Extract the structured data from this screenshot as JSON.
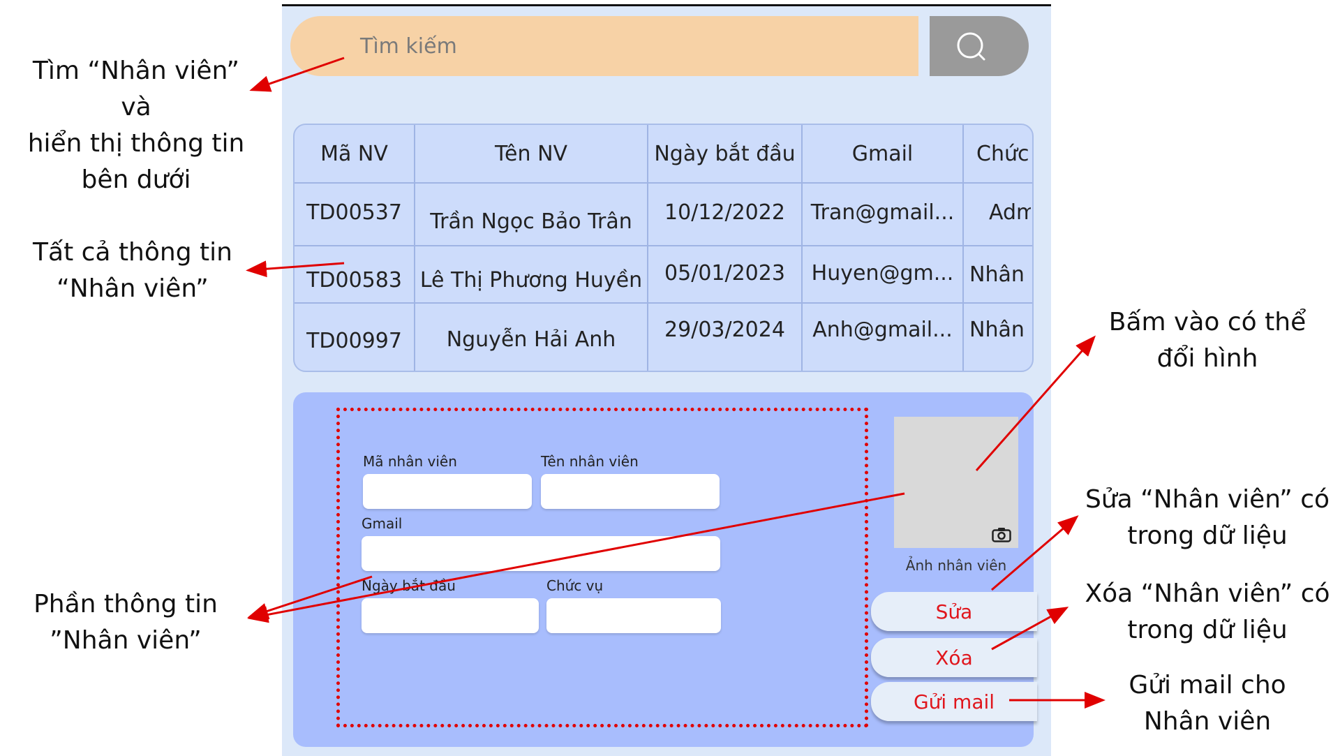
{
  "search": {
    "placeholder": "Tìm kiếm",
    "icon": "search-icon"
  },
  "table": {
    "headers": [
      "Mã NV",
      "Tên NV",
      "Ngày bắt đầu",
      "Gmail",
      "Chức"
    ],
    "rows": [
      [
        "TD00537",
        "Trần Ngọc Bảo Trân",
        "10/12/2022",
        "Tran@gmail...",
        "Adm"
      ],
      [
        "TD00583",
        "Lê Thị Phương Huyền",
        "05/01/2023",
        "Huyen@gm...",
        "Nhân v"
      ],
      [
        "TD00997",
        "Nguyễn Hải Anh",
        "29/03/2024",
        "Anh@gmail...",
        "Nhân v"
      ]
    ]
  },
  "form": {
    "ma_label": "Mã nhân viên",
    "ten_label": "Tên nhân viên",
    "gmail_label": "Gmail",
    "ngay_label": "Ngày bắt đầu",
    "chucvu_label": "Chức vụ",
    "ma_value": "",
    "ten_value": "",
    "gmail_value": "",
    "ngay_value": "",
    "chucvu_value": ""
  },
  "photo": {
    "label": "Ảnh nhân viên",
    "icon": "camera-icon"
  },
  "actions": {
    "edit": "Sửa",
    "delete": "Xóa",
    "mail": "Gửi mail"
  },
  "annotations": {
    "search_note": [
      "Tìm “Nhân viên” và",
      "hiển thị thông tin",
      "bên dưới"
    ],
    "table_note": [
      "Tất cả thông tin",
      "“Nhân viên”"
    ],
    "form_note": [
      "Phần thông tin",
      "”Nhân viên”"
    ],
    "photo_note": [
      "Bấm vào có thể",
      "đổi hình"
    ],
    "edit_note": [
      "Sửa “Nhân viên” có",
      "trong dữ liệu"
    ],
    "delete_note": [
      "Xóa “Nhân viên” có",
      "trong dữ liệu"
    ],
    "mail_note": [
      "Gửi mail cho",
      "Nhân viên"
    ]
  },
  "colors": {
    "search_bar": "#f7d2a6",
    "search_button": "#9a9a9a",
    "table_bg": "#cddcfb",
    "panel_bg": "#a8bdfd",
    "action_text": "#e0151c",
    "arrow": "#e00000"
  }
}
